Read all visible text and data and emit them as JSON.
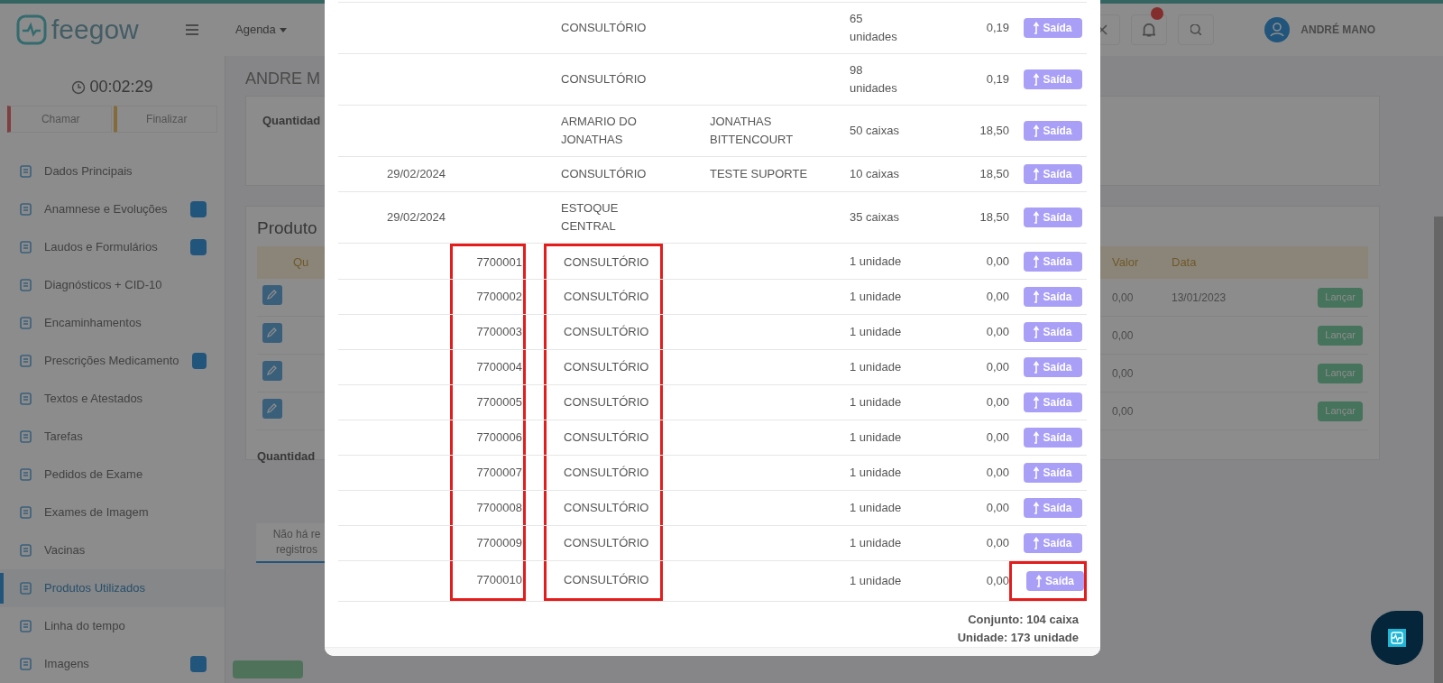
{
  "app": {
    "logo": "feegow",
    "nav": [
      {
        "label": "Agenda"
      }
    ],
    "notifications": {
      "alert": true
    },
    "user": {
      "name": "ANDRÉ MANO"
    }
  },
  "timer": "00:02:29",
  "session_buttons": [
    {
      "label": "Chamar",
      "kind": "call"
    },
    {
      "label": "Finalizar",
      "kind": "finish"
    }
  ],
  "sidebar": {
    "items": [
      {
        "label": "Dados Principais",
        "badge": false,
        "selected": false
      },
      {
        "label": "Anamnese e Evoluções",
        "badge": true,
        "selected": false
      },
      {
        "label": "Laudos e Formulários",
        "badge": true,
        "selected": false
      },
      {
        "label": "Diagnósticos + CID-10",
        "badge": false,
        "selected": false
      },
      {
        "label": "Encaminhamentos",
        "badge": false,
        "selected": false
      },
      {
        "label": "Prescrições Medicamento",
        "badge": true,
        "selected": false
      },
      {
        "label": "Textos e Atestados",
        "badge": false,
        "selected": false
      },
      {
        "label": "Tarefas",
        "badge": false,
        "selected": false
      },
      {
        "label": "Pedidos de Exame",
        "badge": false,
        "selected": false
      },
      {
        "label": "Exames de Imagem",
        "badge": false,
        "selected": false
      },
      {
        "label": "Vacinas",
        "badge": false,
        "selected": false
      },
      {
        "label": "Produtos Utilizados",
        "badge": false,
        "selected": true
      },
      {
        "label": "Linha do tempo",
        "badge": false,
        "selected": false
      },
      {
        "label": "Imagens",
        "badge": true,
        "selected": false
      }
    ]
  },
  "content": {
    "title": "ANDRE M",
    "summary_label": "Quantidad",
    "products": {
      "title": "Produto",
      "columns": {
        "first": "Qu",
        "value": "Valor",
        "date": "Data"
      },
      "rows": [
        {
          "value": "0,00",
          "date": "13/01/2023",
          "action": "Lançar"
        },
        {
          "value": "0,00",
          "action": "Lançar"
        },
        {
          "value": "0,00",
          "action": "Lançar"
        },
        {
          "value": "0,00",
          "action": "Lançar"
        }
      ],
      "footer_label": "Quantidad"
    },
    "tab": {
      "lines": [
        "Não há re",
        "registros"
      ]
    }
  },
  "modal": {
    "rows": [
      {
        "location": "CONSULTÓRIO",
        "quantity": "65 unidades",
        "value": "0,19",
        "action": "Saída"
      },
      {
        "location": "CONSULTÓRIO",
        "quantity": "98 unidades",
        "value": "0,19",
        "action": "Saída"
      },
      {
        "location": "ARMARIO DO JONATHAS",
        "responsible": "JONATHAS BITTENCOURT",
        "quantity": "50 caixas",
        "value": "18,50",
        "action": "Saída"
      },
      {
        "date": "29/02/2024",
        "location": "CONSULTÓRIO",
        "responsible": "TESTE SUPORTE",
        "quantity": "10 caixas",
        "value": "18,50",
        "action": "Saída"
      },
      {
        "date": "29/02/2024",
        "location": "ESTOQUE CENTRAL",
        "quantity": "35 caixas",
        "value": "18,50",
        "action": "Saída"
      },
      {
        "code": "7700001",
        "location": "CONSULTÓRIO",
        "quantity": "1 unidade",
        "value": "0,00",
        "action": "Saída",
        "highlighted": {
          "code": true,
          "location": true,
          "action": false
        }
      },
      {
        "code": "7700002",
        "location": "CONSULTÓRIO",
        "quantity": "1 unidade",
        "value": "0,00",
        "action": "Saída",
        "highlighted": {
          "code": true,
          "location": true,
          "action": false
        }
      },
      {
        "code": "7700003",
        "location": "CONSULTÓRIO",
        "quantity": "1 unidade",
        "value": "0,00",
        "action": "Saída",
        "highlighted": {
          "code": true,
          "location": true,
          "action": false
        }
      },
      {
        "code": "7700004",
        "location": "CONSULTÓRIO",
        "quantity": "1 unidade",
        "value": "0,00",
        "action": "Saída",
        "highlighted": {
          "code": true,
          "location": true,
          "action": false
        }
      },
      {
        "code": "7700005",
        "location": "CONSULTÓRIO",
        "quantity": "1 unidade",
        "value": "0,00",
        "action": "Saída",
        "highlighted": {
          "code": true,
          "location": true,
          "action": false
        }
      },
      {
        "code": "7700006",
        "location": "CONSULTÓRIO",
        "quantity": "1 unidade",
        "value": "0,00",
        "action": "Saída",
        "highlighted": {
          "code": true,
          "location": true,
          "action": false
        }
      },
      {
        "code": "7700007",
        "location": "CONSULTÓRIO",
        "quantity": "1 unidade",
        "value": "0,00",
        "action": "Saída",
        "highlighted": {
          "code": true,
          "location": true,
          "action": false
        }
      },
      {
        "code": "7700008",
        "location": "CONSULTÓRIO",
        "quantity": "1 unidade",
        "value": "0,00",
        "action": "Saída",
        "highlighted": {
          "code": true,
          "location": true,
          "action": false
        }
      },
      {
        "code": "7700009",
        "location": "CONSULTÓRIO",
        "quantity": "1 unidade",
        "value": "0,00",
        "action": "Saída",
        "highlighted": {
          "code": true,
          "location": true,
          "action": false
        }
      },
      {
        "code": "7700010",
        "location": "CONSULTÓRIO",
        "quantity": "1 unidade",
        "value": "0,00",
        "action": "Saída",
        "highlighted": {
          "code": true,
          "location": true,
          "action": true
        }
      }
    ],
    "totals": [
      "Conjunto: 104 caixa",
      "Unidade: 173 unidade"
    ]
  }
}
